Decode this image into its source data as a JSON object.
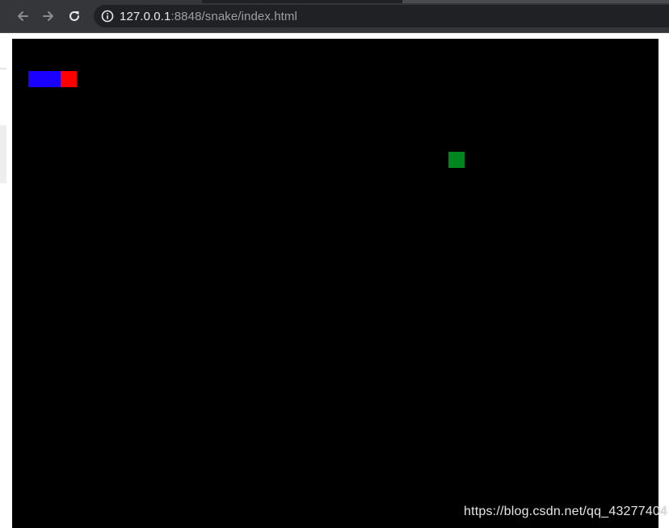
{
  "browser": {
    "url_host": "127.0.0.1",
    "url_rest": ":8848/snake/index.html",
    "icons": {
      "back": "back-arrow-icon",
      "forward": "forward-arrow-icon",
      "reload": "reload-icon",
      "site_info": "info-icon"
    }
  },
  "game": {
    "background_color": "#000000",
    "snake_body_color": "#1a00ff",
    "snake_head_color": "#ff0000",
    "food_color": "#00861f"
  },
  "watermark": "https://blog.csdn.net/qq_43277404"
}
